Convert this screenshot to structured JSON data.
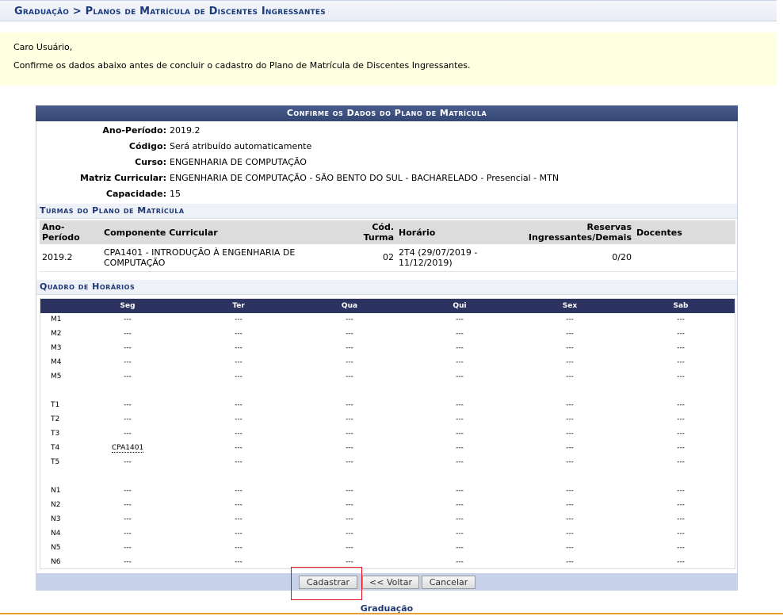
{
  "header": {
    "breadcrumb": "Graduação > Planos de Matrícula de Discentes Ingressantes"
  },
  "notice": {
    "greeting": "Caro Usuário,",
    "message": "Confirme os dados abaixo antes de concluir o cadastro do Plano de Matrícula de Discentes Ingressantes."
  },
  "form": {
    "caption": "Confirme os Dados do Plano de Matrícula",
    "fields": [
      {
        "label": "Ano-Período:",
        "value": "2019.2"
      },
      {
        "label": "Código:",
        "value": "Será atribuído automaticamente"
      },
      {
        "label": "Curso:",
        "value": "ENGENHARIA DE COMPUTAÇÃO"
      },
      {
        "label": "Matriz Curricular:",
        "value": "ENGENHARIA DE COMPUTAÇÃO - SÃO BENTO DO SUL - BACHARELADO - Presencial - MTN"
      },
      {
        "label": "Capacidade:",
        "value": "15"
      }
    ]
  },
  "turmas": {
    "caption": "Turmas do Plano de Matrícula",
    "headers": {
      "ano_line1": "Ano-",
      "ano_line2": "Período",
      "componente": "Componente Curricular",
      "cod_line1": "Cód.",
      "cod_line2": "Turma",
      "horario": "Horário",
      "reservas_line1": "Reservas",
      "reservas_line2": "Ingressantes/Demais",
      "docentes": "Docentes"
    },
    "rows": [
      {
        "ano": "2019.2",
        "componente_line1": "CPA1401 - INTRODUÇÃO À ENGENHARIA DE",
        "componente_line2": "COMPUTAÇÃO",
        "cod": "02",
        "horario_line1": "2T4 (29/07/2019 -",
        "horario_line2": "11/12/2019)",
        "reservas": "0/20",
        "docentes": ""
      }
    ]
  },
  "horarios": {
    "caption": "Quadro de Horários",
    "days": [
      "Seg",
      "Ter",
      "Qua",
      "Qui",
      "Sex",
      "Sab"
    ],
    "empty": "---",
    "groups": [
      [
        "M1",
        "M2",
        "M3",
        "M4",
        "M5"
      ],
      [
        "T1",
        "T2",
        "T3",
        "T4",
        "T5"
      ],
      [
        "N1",
        "N2",
        "N3",
        "N4",
        "N5",
        "N6"
      ]
    ],
    "filled": {
      "T4": {
        "0": "CPA1401"
      }
    }
  },
  "buttons": {
    "cadastrar": "Cadastrar",
    "voltar": "<< Voltar",
    "cancelar": "Cancelar"
  },
  "footer": {
    "link": "Graduação"
  },
  "colors": {
    "caption_bg": "#344672",
    "highlight": "#e0101a",
    "notice_bg": "#fefee0"
  }
}
